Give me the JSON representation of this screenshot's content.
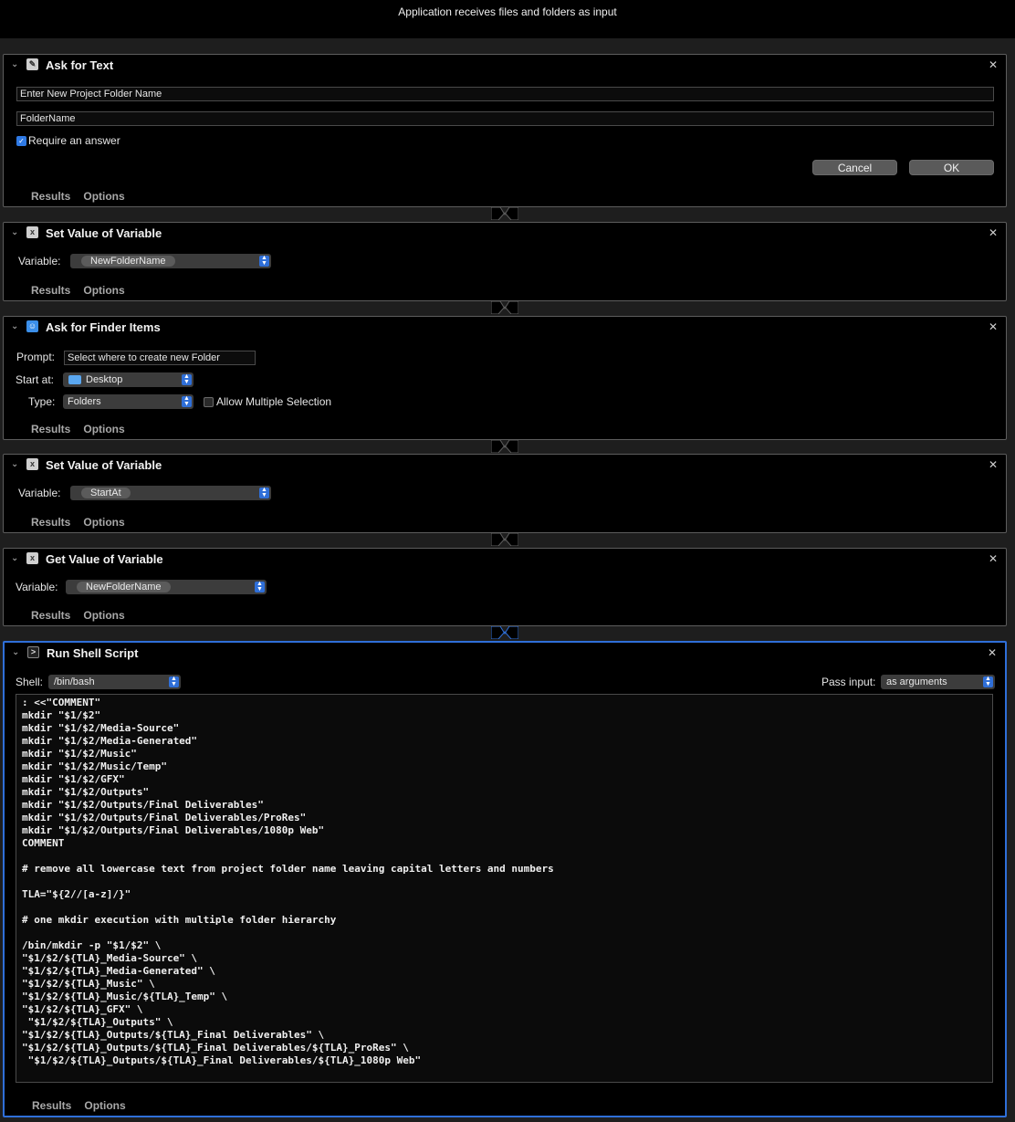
{
  "header": {
    "subtitle": "Application receives files and folders as input"
  },
  "common": {
    "results": "Results",
    "options": "Options"
  },
  "ask_text": {
    "title": "Ask for Text",
    "question": "Enter New Project Folder Name",
    "default_answer": "FolderName",
    "require_label": "Require an answer",
    "require_checked": true,
    "cancel": "Cancel",
    "ok": "OK"
  },
  "set_var1": {
    "title": "Set Value of Variable",
    "var_label": "Variable:",
    "var_value": "NewFolderName"
  },
  "ask_finder": {
    "title": "Ask for Finder Items",
    "prompt_label": "Prompt:",
    "prompt_value": "Select where to create new Folder",
    "start_label": "Start at:",
    "start_value": "Desktop",
    "type_label": "Type:",
    "type_value": "Folders",
    "multi_label": "Allow Multiple Selection",
    "multi_checked": false
  },
  "set_var2": {
    "title": "Set Value of Variable",
    "var_label": "Variable:",
    "var_value": "StartAt"
  },
  "get_var": {
    "title": "Get Value of Variable",
    "var_label": "Variable:",
    "var_value": "NewFolderName"
  },
  "shell": {
    "title": "Run Shell Script",
    "shell_label": "Shell:",
    "shell_value": "/bin/bash",
    "pass_label": "Pass input:",
    "pass_value": "as arguments",
    "code": ": <<\"COMMENT\"\nmkdir \"$1/$2\"\nmkdir \"$1/$2/Media-Source\"\nmkdir \"$1/$2/Media-Generated\"\nmkdir \"$1/$2/Music\"\nmkdir \"$1/$2/Music/Temp\"\nmkdir \"$1/$2/GFX\"\nmkdir \"$1/$2/Outputs\"\nmkdir \"$1/$2/Outputs/Final Deliverables\"\nmkdir \"$1/$2/Outputs/Final Deliverables/ProRes\"\nmkdir \"$1/$2/Outputs/Final Deliverables/1080p Web\"\nCOMMENT\n\n# remove all lowercase text from project folder name leaving capital letters and numbers\n\nTLA=\"${2//[a-z]/}\"\n\n# one mkdir execution with multiple folder hierarchy\n\n/bin/mkdir -p \"$1/$2\" \\\n\"$1/$2/${TLA}_Media-Source\" \\\n\"$1/$2/${TLA}_Media-Generated\" \\\n\"$1/$2/${TLA}_Music\" \\\n\"$1/$2/${TLA}_Music/${TLA}_Temp\" \\\n\"$1/$2/${TLA}_GFX\" \\\n \"$1/$2/${TLA}_Outputs\" \\\n\"$1/$2/${TLA}_Outputs/${TLA}_Final Deliverables\" \\\n\"$1/$2/${TLA}_Outputs/${TLA}_Final Deliverables/${TLA}_ProRes\" \\\n \"$1/$2/${TLA}_Outputs/${TLA}_Final Deliverables/${TLA}_1080p Web\""
  }
}
